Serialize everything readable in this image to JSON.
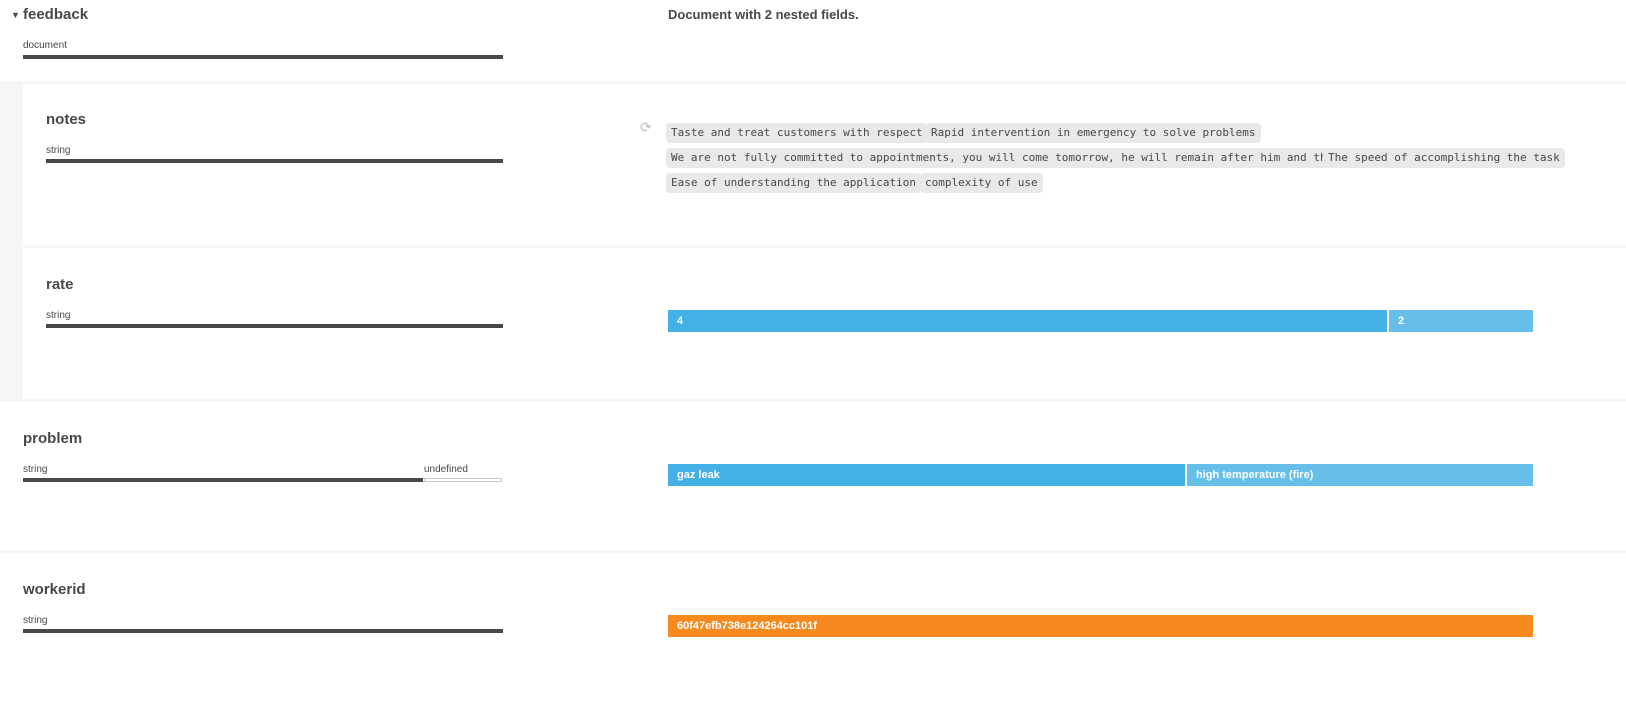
{
  "root": {
    "name": "feedback",
    "type": "document",
    "description": "Document with 2 nested fields."
  },
  "fields": {
    "notes": {
      "name": "notes",
      "type": "string",
      "values": [
        "Taste and treat customers with respect",
        "Rapid intervention in emergency to solve problems",
        "We are not fully committed to appointments, you will come tomorrow, he will remain after him and that",
        "The speed of accomplishing the task",
        "Ease of understanding the application",
        "complexity of use"
      ],
      "refresh_icon": "refresh-icon"
    },
    "rate": {
      "name": "rate",
      "type": "string",
      "segments": [
        {
          "label": "4",
          "fraction": 0.833,
          "color": "#43b1e5"
        },
        {
          "label": "2",
          "fraction": 0.167,
          "color": "#65bfe9"
        }
      ]
    },
    "problem": {
      "name": "problem",
      "type": "string",
      "type2": "undefined",
      "type_fractions": {
        "string": 0.84,
        "undefined": 0.16
      },
      "segments": [
        {
          "label": "gaz leak",
          "fraction": 0.6,
          "color": "#43b1e5"
        },
        {
          "label": "high temperature (fire)",
          "fraction": 0.4,
          "color": "#65bfe9"
        }
      ]
    },
    "workerid": {
      "name": "workerid",
      "type": "string",
      "segments": [
        {
          "label": "60f47efb738e124264cc101f",
          "fraction": 1.0,
          "color": "#f68a1e"
        }
      ]
    }
  }
}
